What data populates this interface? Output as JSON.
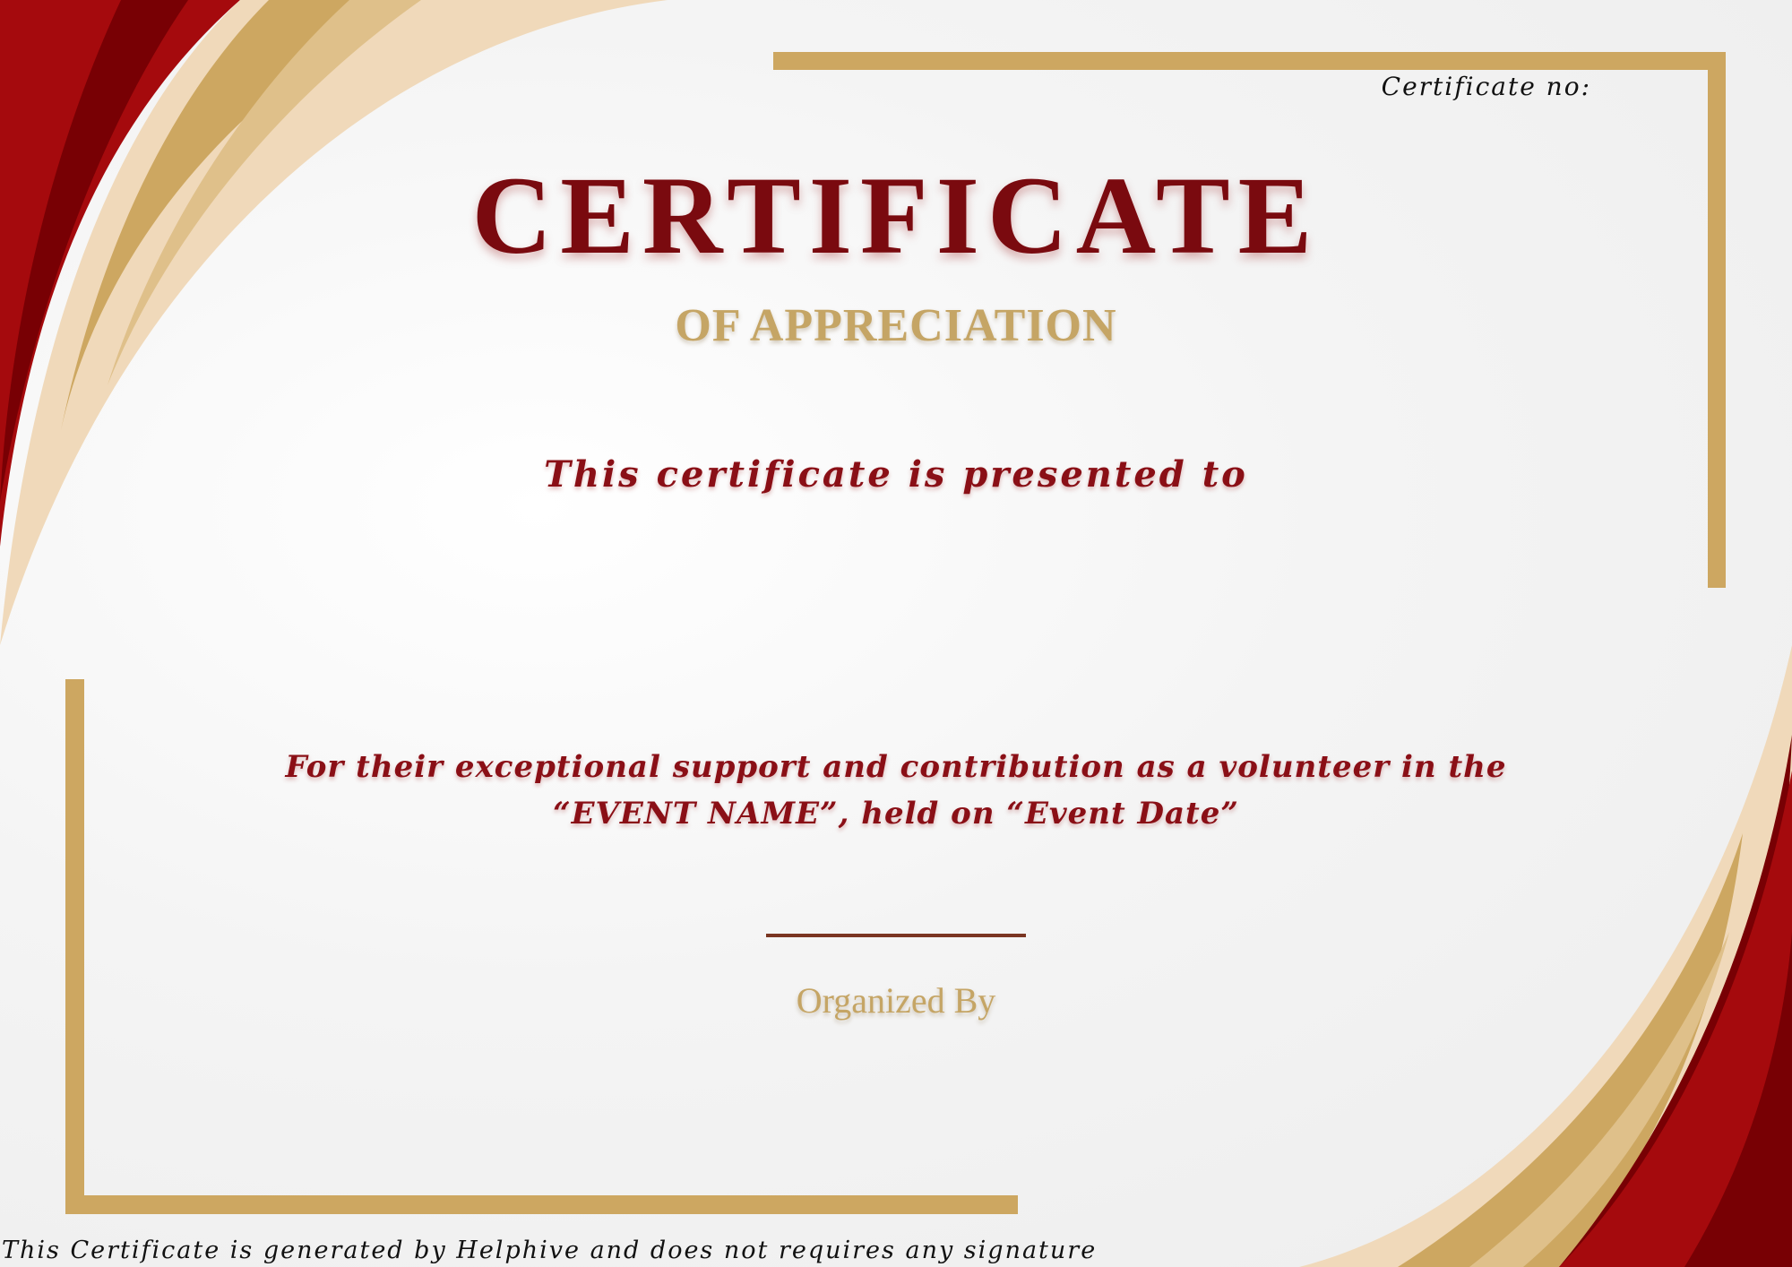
{
  "certificate": {
    "number_label": "Certificate no:",
    "title": "CERTIFICATE",
    "subtitle": "OF APPRECIATION",
    "presented_to": "This certificate is presented to",
    "description_line_1": "For their exceptional support and contribution as a volunteer in the",
    "description_line_2": "“EVENT NAME”, held on “Event Date”",
    "organized_by": "Organized By",
    "footer_note": "This Certificate is generated by Helphive and does not requires any signature"
  },
  "colors": {
    "red": "#a50a0d",
    "dark_red": "#780004",
    "gold": "#cda761",
    "cream": "#f0d9ba",
    "title_red": "#7a0a0f",
    "text_red": "#8a0f16"
  }
}
